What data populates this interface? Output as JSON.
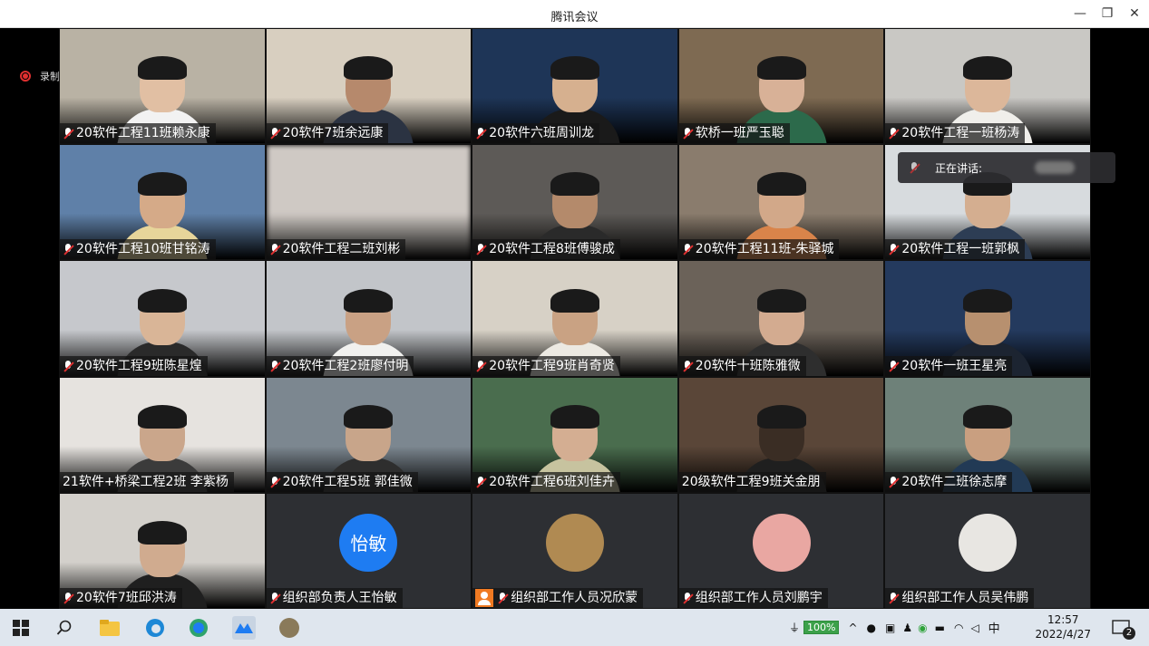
{
  "window": {
    "title": "腾讯会议"
  },
  "recording": {
    "label": "录制中"
  },
  "speaking": {
    "label": "正在讲话:"
  },
  "tiles": [
    {
      "name": "20软件工程11班赖永康",
      "bg": "#b9b2a4",
      "skin": "#e1bfa3",
      "shirt": "#f2f2f2",
      "muted": true
    },
    {
      "name": "20软件7班余远康",
      "bg": "#d8cfc0",
      "skin": "#b6896c",
      "shirt": "#2b3342",
      "muted": true
    },
    {
      "name": "20软件六班周训龙",
      "bg": "#1e3557",
      "skin": "#d6b08f",
      "shirt": "#1a1a1a",
      "muted": true
    },
    {
      "name": "软桥一班严玉聪",
      "bg": "#7e6a52",
      "skin": "#d8b197",
      "shirt": "#2c6a4b",
      "muted": true
    },
    {
      "name": "20软件工程一班杨涛",
      "bg": "#c9c8c4",
      "skin": "#dcb79a",
      "shirt": "#f0efeb",
      "muted": true
    },
    {
      "name": "20软件工程10班甘铭涛",
      "bg": "#5f80a8",
      "skin": "#d5aa88",
      "shirt": "#e7d59a",
      "muted": true
    },
    {
      "name": "20软件工程二班刘彬",
      "bg": "#cfc9c4",
      "skin": "#cfc9c4",
      "shirt": "#cfc9c4",
      "muted": true,
      "blurred": true
    },
    {
      "name": "20软件工程8班傅骏成",
      "bg": "#5d5a57",
      "skin": "#b48a6b",
      "shirt": "#2a2a2a",
      "muted": true
    },
    {
      "name": "20软件工程11班-朱驿城",
      "bg": "#8a7c6d",
      "skin": "#d2a889",
      "shirt": "#d9844a",
      "muted": true
    },
    {
      "name": "20软件工程一班郭枫",
      "bg": "#d7dbde",
      "skin": "#d4ae90",
      "shirt": "#2d3d54",
      "muted": true
    },
    {
      "name": "20软件工程9班陈星煌",
      "bg": "#c6c8cc",
      "skin": "#d9b597",
      "shirt": "#2a2a2a",
      "muted": true
    },
    {
      "name": "20软件工程2班廖付明",
      "bg": "#c2c5c9",
      "skin": "#c9a184",
      "shirt": "#f1f1ef",
      "muted": true
    },
    {
      "name": "20软件工程9班肖奇贤",
      "bg": "#d7d1c6",
      "skin": "#c9a283",
      "shirt": "#ece9e2",
      "muted": true
    },
    {
      "name": "20软件十班陈雅微",
      "bg": "#6b6259",
      "skin": "#d3ab90",
      "shirt": "#2e2e2e",
      "muted": true
    },
    {
      "name": "20软件一班王星亮",
      "bg": "#243a5e",
      "skin": "#b7906f",
      "shirt": "#1c2431",
      "muted": true
    },
    {
      "name": "21软件+桥梁工程2班 李紫杨",
      "bg": "#e6e3df",
      "skin": "#caa68b",
      "shirt": "#3b3b3b",
      "muted": false
    },
    {
      "name": "20软件工程5班 郭佳微",
      "bg": "#7c8790",
      "skin": "#c8a58a",
      "shirt": "#2e2e2e",
      "muted": true
    },
    {
      "name": "20软件工程6班刘佳卉",
      "bg": "#4a6d4e",
      "skin": "#d4ae92",
      "shirt": "#c7c39f",
      "muted": true
    },
    {
      "name": "20级软件工程9班关金朋",
      "bg": "#5a4638",
      "skin": "#3a2d24",
      "shirt": "#1f1f1f",
      "muted": false
    },
    {
      "name": "20软件二班徐志摩",
      "bg": "#6e8179",
      "skin": "#c99f80",
      "shirt": "#223a55",
      "muted": true
    },
    {
      "name": "20软件7班邱洪涛",
      "bg": "#d3d0cb",
      "skin": "#d0ab8f",
      "shirt": "#1f1f1f",
      "muted": true
    }
  ],
  "avatar_tiles": [
    {
      "name": "组织部负责人王怡敏",
      "avatar_text": "怡敏",
      "avatar_color": "#1e7cf2",
      "muted": true,
      "host_badge": false
    },
    {
      "name": "组织部工作人员况欣蒙",
      "avatar_text": "",
      "avatar_color": "#b08a52",
      "muted": true,
      "host_badge": true
    },
    {
      "name": "组织部工作人员刘鹏宇",
      "avatar_text": "",
      "avatar_color": "#e9a7a2",
      "muted": true,
      "host_badge": false
    },
    {
      "name": "组织部工作人员吴伟鹏",
      "avatar_text": "",
      "avatar_color": "#e8e6e2",
      "muted": true,
      "host_badge": false
    }
  ],
  "taskbar": {
    "battery": "100%",
    "ime": "中",
    "time": "12:57",
    "date": "2022/4/27",
    "notifications": "2"
  },
  "colors": {
    "accent": "#1e7cf2",
    "record": "#e03030"
  }
}
